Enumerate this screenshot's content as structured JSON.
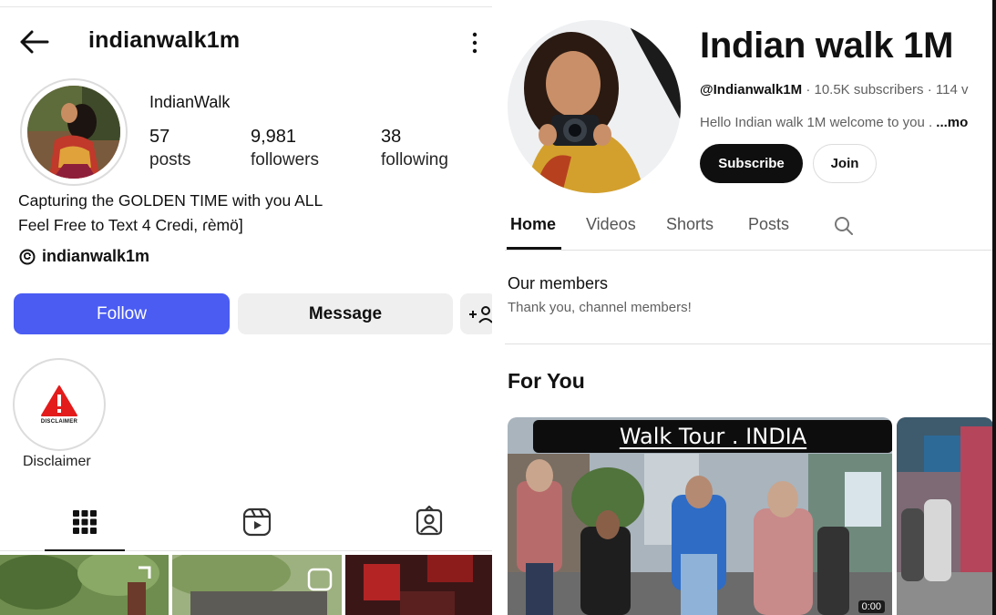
{
  "instagram": {
    "header": {
      "username": "indianwalk1m",
      "back_icon": "arrow-left-icon",
      "more_icon": "more-vertical-icon"
    },
    "profile": {
      "display_name": "IndianWalk"
    },
    "stats": [
      {
        "value": "57",
        "label": "posts"
      },
      {
        "value": "9,981",
        "label": "followers"
      },
      {
        "value": "38",
        "label": "following"
      }
    ],
    "bio": {
      "line1": "Capturing the GOLDEN TIME with you ALL",
      "line2": "Feel Free to Text  4 Credi, ɾèmö]"
    },
    "threads": {
      "handle": "indianwalk1m",
      "icon": "threads-icon"
    },
    "buttons": {
      "follow": "Follow",
      "message": "Message",
      "add_user_icon": "add-user-icon"
    },
    "highlight": {
      "label": "Disclaimer",
      "badge_text": "DISCLAIMER",
      "badge_color": "#e31b1b"
    },
    "tabs": [
      "grid-icon",
      "reels-icon",
      "tagged-icon"
    ],
    "colors": {
      "follow_button": "#4a5cf2"
    }
  },
  "youtube": {
    "channel_name": "Indian walk 1M",
    "handle": "@Indianwalk1M",
    "meta_rest": " · 10.5K subscribers · 114 v",
    "description": "Hello Indian walk 1M welcome to you . ",
    "description_more": "...mo",
    "buttons": {
      "subscribe": "Subscribe",
      "join": "Join"
    },
    "tabs": [
      "Home",
      "Videos",
      "Shorts",
      "Posts"
    ],
    "active_tab": "Home",
    "members": {
      "title": "Our members",
      "subtitle": "Thank you, channel members!"
    },
    "section_title": "For You",
    "video": {
      "banner_text": "Walk Tour . INDIA",
      "duration": "0:00"
    }
  }
}
